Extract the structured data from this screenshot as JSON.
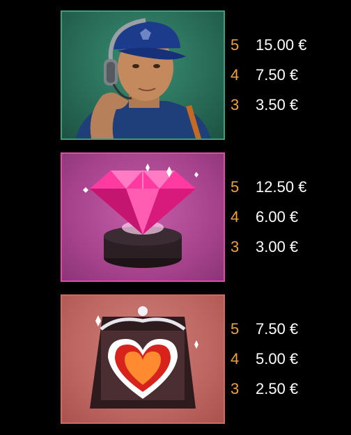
{
  "paytable": {
    "symbols": [
      {
        "icon": "pilot-icon",
        "background": "#2f7a63",
        "border": "#3f9e80",
        "pays": [
          {
            "count": "5",
            "value": "15.00 €"
          },
          {
            "count": "4",
            "value": "7.50 €"
          },
          {
            "count": "3",
            "value": "3.50 €"
          }
        ]
      },
      {
        "icon": "pink-diamond-icon",
        "background": "#b04f96",
        "border": "#e04aa8",
        "pays": [
          {
            "count": "5",
            "value": "12.50 €"
          },
          {
            "count": "4",
            "value": "6.00 €"
          },
          {
            "count": "3",
            "value": "3.00 €"
          }
        ]
      },
      {
        "icon": "heart-jewel-icon",
        "background": "#c46f6a",
        "border": "#d06a60",
        "pays": [
          {
            "count": "5",
            "value": "7.50 €"
          },
          {
            "count": "4",
            "value": "5.00 €"
          },
          {
            "count": "3",
            "value": "2.50 €"
          }
        ]
      }
    ],
    "count_color": "#f0a238",
    "value_color": "#ffffff"
  }
}
